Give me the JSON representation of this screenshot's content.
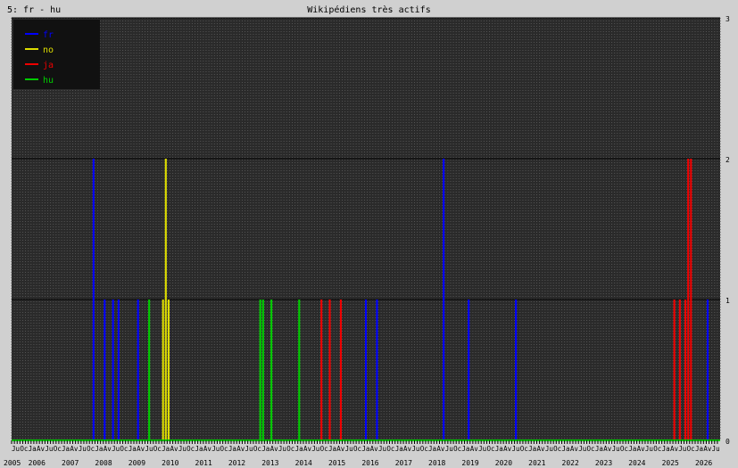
{
  "header": {
    "chart_label": "5: fr - hu",
    "title": "Wikipédiens très actifs"
  },
  "colors": {
    "background": "#d0d0d0",
    "plot_bg": "#2a2a2a",
    "grid": "#555555",
    "legend_bg": "#111111",
    "axis_line": "#00cc00"
  },
  "chart_data": {
    "type": "bar",
    "title": "Wikipédiens très actifs",
    "xlabel": "",
    "ylabel": "",
    "ylim": [
      0,
      3
    ],
    "y_ticks": [
      0,
      1,
      2,
      3
    ],
    "x_range": [
      "2005-07",
      "2026-09"
    ],
    "x_year_labels": [
      "2005",
      "2006",
      "2007",
      "2008",
      "2009",
      "2010",
      "2011",
      "2012",
      "2013",
      "2014",
      "2015",
      "2016",
      "2017",
      "2018",
      "2019",
      "2020",
      "2021",
      "2022",
      "2023",
      "2024",
      "2025",
      "2026"
    ],
    "x_month_label_cycle": [
      "Ju",
      "Oc",
      "Ja",
      "Av"
    ],
    "legend_position": "top-left",
    "grid": true,
    "series": [
      {
        "name": "fr",
        "color": "#0000ff",
        "points": [
          {
            "month": "2007-12",
            "value": 2
          },
          {
            "month": "2008-04",
            "value": 1
          },
          {
            "month": "2008-07",
            "value": 1
          },
          {
            "month": "2008-09",
            "value": 1
          },
          {
            "month": "2009-04",
            "value": 1
          },
          {
            "month": "2016-02",
            "value": 1
          },
          {
            "month": "2016-06",
            "value": 1
          },
          {
            "month": "2018-06",
            "value": 2
          },
          {
            "month": "2019-03",
            "value": 1
          },
          {
            "month": "2020-08",
            "value": 1
          },
          {
            "month": "2026-05",
            "value": 1
          }
        ]
      },
      {
        "name": "no",
        "color": "#dddd00",
        "points": [
          {
            "month": "2010-01",
            "value": 1
          },
          {
            "month": "2010-02",
            "value": 2
          },
          {
            "month": "2010-03",
            "value": 1
          }
        ]
      },
      {
        "name": "ja",
        "color": "#ee0000",
        "points": [
          {
            "month": "2014-10",
            "value": 1
          },
          {
            "month": "2015-01",
            "value": 1
          },
          {
            "month": "2015-05",
            "value": 1
          },
          {
            "month": "2025-05",
            "value": 1
          },
          {
            "month": "2025-07",
            "value": 1
          },
          {
            "month": "2025-09",
            "value": 1
          },
          {
            "month": "2025-10",
            "value": 2
          },
          {
            "month": "2025-11",
            "value": 2
          }
        ]
      },
      {
        "name": "hu",
        "color": "#00cc00",
        "points": [
          {
            "month": "2009-08",
            "value": 1
          },
          {
            "month": "2012-12",
            "value": 1
          },
          {
            "month": "2013-01",
            "value": 1
          },
          {
            "month": "2013-04",
            "value": 1
          },
          {
            "month": "2014-02",
            "value": 1
          }
        ]
      }
    ]
  }
}
